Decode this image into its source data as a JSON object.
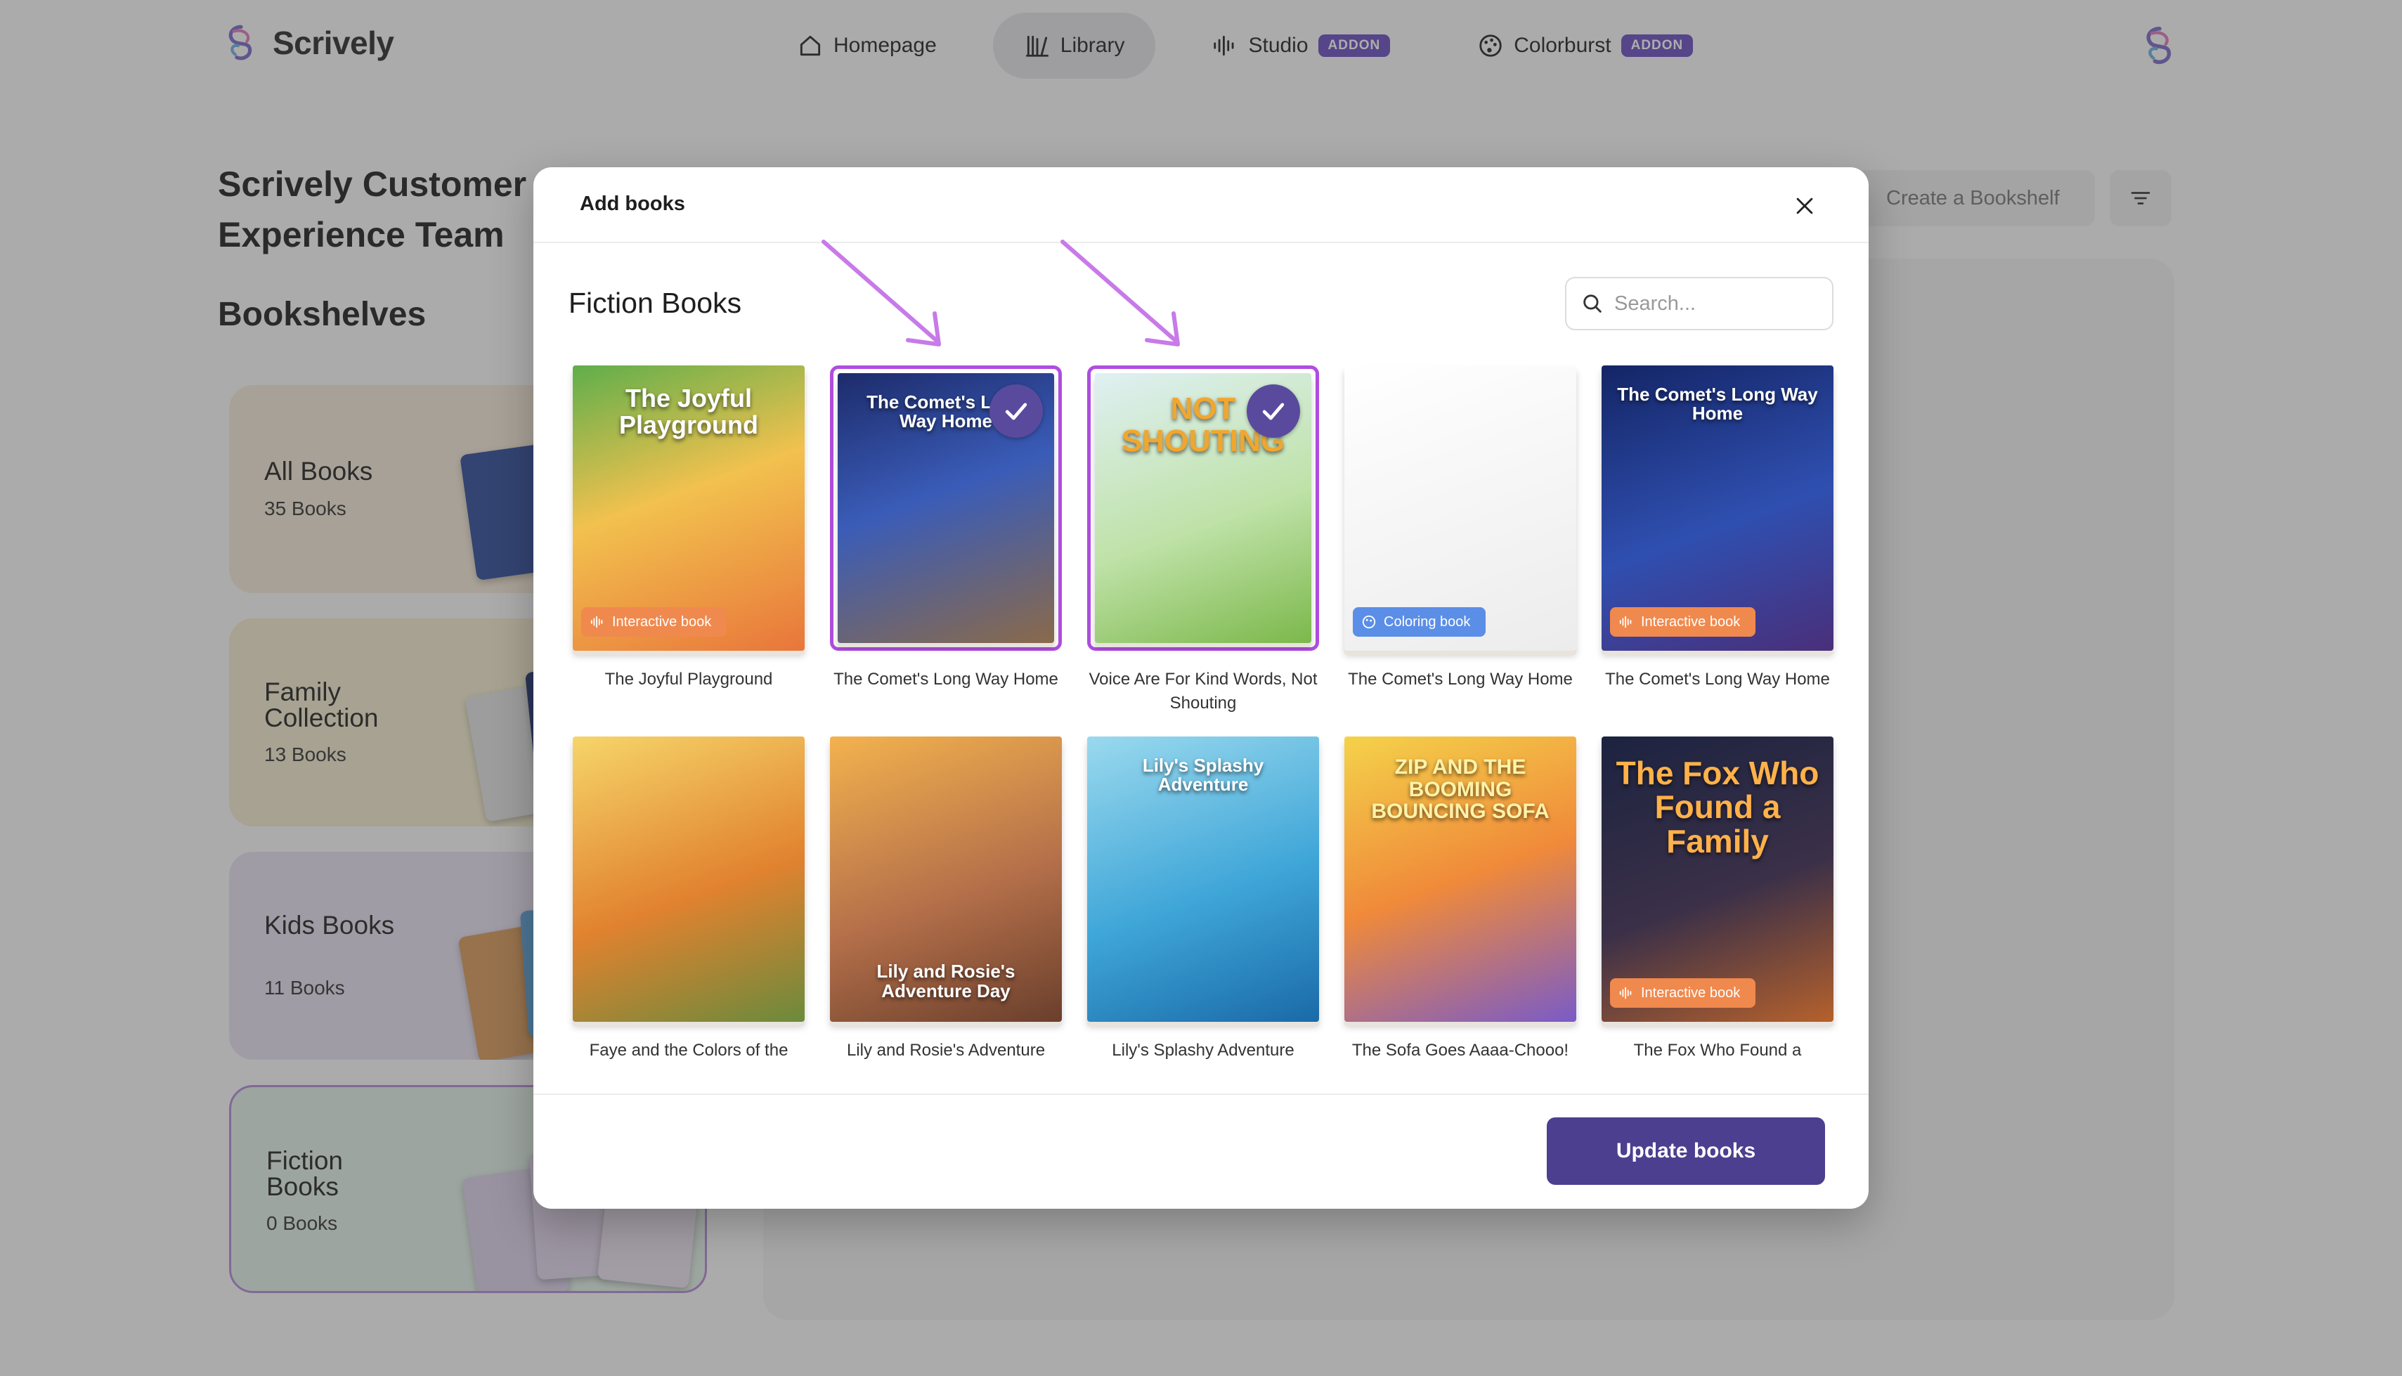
{
  "app": {
    "brand": "Scrively",
    "nav": [
      {
        "label": "Homepage",
        "icon": "home-icon",
        "active": false
      },
      {
        "label": "Library",
        "icon": "library-icon",
        "active": true
      },
      {
        "label": "Studio",
        "icon": "audio-wave-icon",
        "badge": "ADDON"
      },
      {
        "label": "Colorburst",
        "icon": "palette-icon",
        "badge": "ADDON"
      }
    ]
  },
  "page": {
    "team_title": "Scrively Customer Experience Team",
    "shelves_title": "Bookshelves",
    "create_bookshelf": "Create a Bookshelf",
    "shelves": [
      {
        "name": "All Books",
        "count": "35 Books",
        "color": "#f6ead9"
      },
      {
        "name": "Family Collection",
        "count": "13 Books",
        "color": "#f5edcf"
      },
      {
        "name": "Kids Books",
        "count": "11 Books",
        "color": "#e8e2f2"
      },
      {
        "name": "Fiction Books",
        "count": "0 Books",
        "color": "#e3f1e8"
      }
    ]
  },
  "modal": {
    "title": "Add books",
    "section": "Fiction Books",
    "search_placeholder": "Search...",
    "update_button": "Update books",
    "books": [
      {
        "title": "The Joyful Playground",
        "cover_text": "The Joyful Playground",
        "badge": "Interactive book",
        "badge_type": "interactive",
        "selected": false,
        "bg": "linear-gradient(160deg,#5fae4b 0%,#f2c14e 45%,#e8763a 100%)"
      },
      {
        "title": "The Comet's Long Way Home",
        "cover_text": "The Comet's Long Way Home",
        "badge": "",
        "badge_type": "",
        "selected": true,
        "bg": "linear-gradient(160deg,#1d2b6b 0%,#3a5cb8 45%,#8a6a4a 100%)"
      },
      {
        "title": "Voice Are For Kind Words, Not Shouting",
        "cover_text": "NOT SHOUTING",
        "badge": "",
        "badge_type": "",
        "selected": true,
        "bg": "linear-gradient(160deg,#dff0f3 0%,#bfe2a8 55%,#7cb84b 100%)"
      },
      {
        "title": "The Comet's Long Way Home",
        "cover_text": "",
        "badge": "Coloring book",
        "badge_type": "coloring",
        "selected": false,
        "bg": "linear-gradient(160deg,#ffffff 0%,#ececec 100%)"
      },
      {
        "title": "The Comet's Long Way Home",
        "cover_text": "The Comet's Long Way Home",
        "badge": "Interactive book",
        "badge_type": "interactive",
        "selected": false,
        "bg": "linear-gradient(160deg,#142566 0%,#2f4fb0 55%,#4a2f7a 100%)"
      },
      {
        "title": "Faye and the Colors of the",
        "cover_text": "",
        "badge": "",
        "badge_type": "",
        "selected": false,
        "bg": "linear-gradient(160deg,#f6d56a 0%,#e1822f 55%,#6b8a3c 100%)"
      },
      {
        "title": "Lily and Rosie's Adventure",
        "cover_text": "Lily and Rosie's Adventure Day",
        "badge": "",
        "badge_type": "",
        "selected": false,
        "bg": "linear-gradient(160deg,#f3b24e 0%,#b5704a 55%,#6a3f2c 100%)"
      },
      {
        "title": "Lily's Splashy Adventure",
        "cover_text": "Lily's Splashy Adventure",
        "badge": "",
        "badge_type": "",
        "selected": false,
        "bg": "linear-gradient(160deg,#9ad9ee 0%,#3fa6d8 55%,#1a6aa8 100%)"
      },
      {
        "title": "The Sofa Goes Aaaa-Chooo!",
        "cover_text": "ZIP AND THE BOOMING BOUNCING SOFA",
        "badge": "",
        "badge_type": "",
        "selected": false,
        "bg": "linear-gradient(160deg,#f4d24a 0%,#f08a3a 50%,#7a5bc7 100%)"
      },
      {
        "title": "The Fox Who Found a",
        "cover_text": "The Fox Who Found a Family",
        "badge": "Interactive book",
        "badge_type": "interactive",
        "selected": false,
        "bg": "linear-gradient(160deg,#1c2340 0%,#3b3048 55%,#b5612c 100%)"
      }
    ]
  },
  "colors": {
    "accent": "#4d3f8f",
    "selection_border": "#b04de0",
    "arrow": "#c77ae8"
  }
}
